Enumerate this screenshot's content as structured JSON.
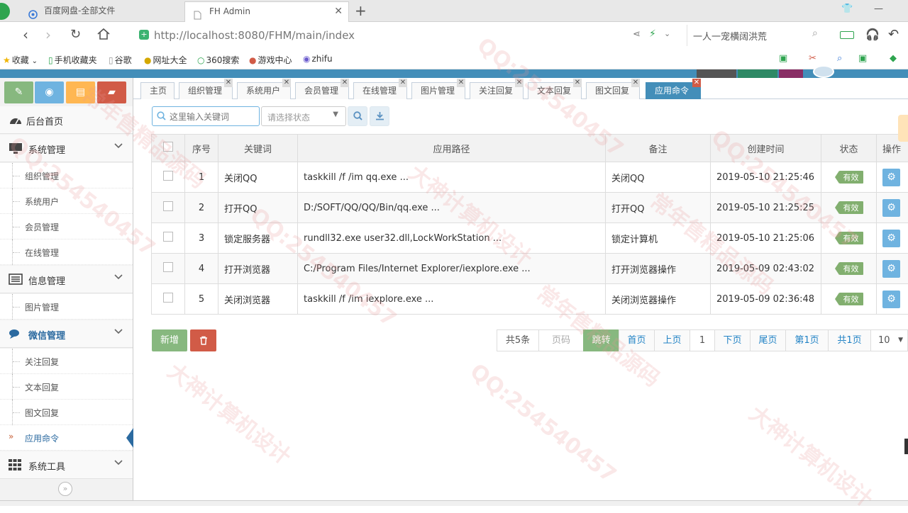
{
  "browser": {
    "tabs": [
      {
        "title": "百度网盘-全部文件"
      },
      {
        "title": "FH Admin"
      }
    ],
    "url": "http://localhost:8080/FHM/main/index",
    "url_host": "localhost",
    "search_text": "一人一宠横阔洪荒",
    "bookmarks": [
      "收藏",
      "手机收藏夹",
      "谷歌",
      "网址大全",
      "360搜索",
      "游戏中心",
      "zhifu"
    ]
  },
  "sidebar": {
    "shortcuts": [
      {
        "icon": "pencil-icon",
        "color": "#87b87f"
      },
      {
        "icon": "eye-icon",
        "color": "#6fb3e0"
      },
      {
        "icon": "book-icon",
        "color": "#ffb752"
      },
      {
        "icon": "folder-icon",
        "color": "#d15b47"
      }
    ],
    "menu": {
      "home": "后台首页",
      "system": "系统管理",
      "system_items": [
        "组织管理",
        "系统用户",
        "会员管理",
        "在线管理"
      ],
      "info": "信息管理",
      "info_items": [
        "图片管理"
      ],
      "wechat": "微信管理",
      "wechat_items": [
        "关注回复",
        "文本回复",
        "图文回复",
        "应用命令"
      ],
      "tools": "系统工具"
    }
  },
  "content_tabs": [
    "主页",
    "组织管理",
    "系统用户",
    "会员管理",
    "在线管理",
    "图片管理",
    "关注回复",
    "文本回复",
    "图文回复",
    "应用命令"
  ],
  "toolbar": {
    "keyword_placeholder": "这里输入关键词",
    "status_placeholder": "请选择状态"
  },
  "table": {
    "headers": [
      "序号",
      "关键词",
      "应用路径",
      "备注",
      "创建时间",
      "状态",
      "操作"
    ],
    "rows": [
      {
        "no": "1",
        "keyword": "关闭QQ",
        "path": "taskkill /f /im qq.exe ...",
        "remark": "关闭QQ",
        "created": "2019-05-10 21:25:46",
        "status": "有效"
      },
      {
        "no": "2",
        "keyword": "打开QQ",
        "path": "D:/SOFT/QQ/QQ/Bin/qq.exe ...",
        "remark": "打开QQ",
        "created": "2019-05-10 21:25:25",
        "status": "有效"
      },
      {
        "no": "3",
        "keyword": "锁定服务器",
        "path": "rundll32.exe user32.dll,LockWorkStation ...",
        "remark": "锁定计算机",
        "created": "2019-05-10 21:25:06",
        "status": "有效"
      },
      {
        "no": "4",
        "keyword": "打开浏览器",
        "path": "C:/Program Files/Internet Explorer/iexplore.exe ...",
        "remark": "打开浏览器操作",
        "created": "2019-05-09 02:43:02",
        "status": "有效"
      },
      {
        "no": "5",
        "keyword": "关闭浏览器",
        "path": "taskkill /f /im iexplore.exe ...",
        "remark": "关闭浏览器操作",
        "created": "2019-05-09 02:36:48",
        "status": "有效"
      }
    ]
  },
  "actions": {
    "add_label": "新增"
  },
  "pager": {
    "total": "共5条",
    "page_placeholder": "页码",
    "jump": "跳转",
    "first": "首页",
    "prev": "上页",
    "current": "1",
    "next": "下页",
    "last": "尾页",
    "page_of": "第1页",
    "pages_total": "共1页",
    "page_size": "10"
  },
  "watermarks": [
    "QQ:254540457",
    "大神计算机设计",
    "常年售精品源码"
  ],
  "colors": {
    "brand_blue": "#438eb9",
    "green": "#87b87f",
    "red": "#d15b47",
    "orange": "#ffb752",
    "light_blue": "#6fb3e0"
  }
}
